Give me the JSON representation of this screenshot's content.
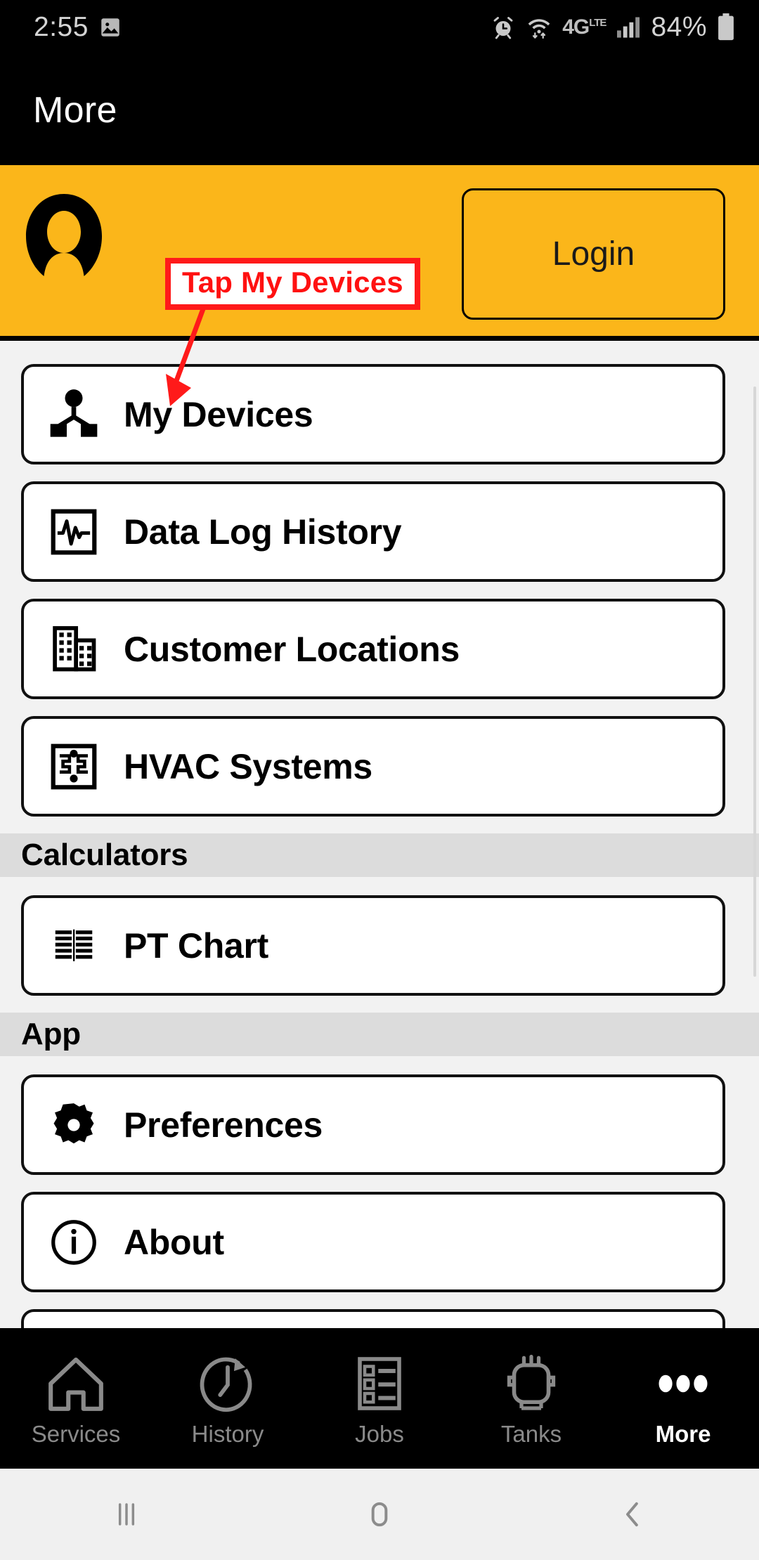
{
  "status_bar": {
    "clock": "2:55",
    "battery_percent": "84%",
    "network": "4G LTE",
    "icons": [
      "image-icon",
      "alarm-icon",
      "wifi-icon",
      "network-4glte-icon",
      "signal-icon",
      "battery-icon"
    ]
  },
  "header": {
    "title": "More"
  },
  "account_bar": {
    "avatar": "person-avatar-icon",
    "login_label": "Login",
    "background_color": "#FBB61A"
  },
  "annotation": {
    "text": "Tap My Devices",
    "color": "#FF1111",
    "border_color": "#FF1A1A",
    "target": "My Devices"
  },
  "menu": {
    "items": [
      {
        "label": "My Devices",
        "icon": "sitemap-icon"
      },
      {
        "label": "Data Log History",
        "icon": "waveform-monitor-icon"
      },
      {
        "label": "Customer Locations",
        "icon": "buildings-icon"
      },
      {
        "label": "HVAC Systems",
        "icon": "hvac-circuit-icon"
      }
    ],
    "sections": [
      {
        "header": "Calculators",
        "items": [
          {
            "label": "PT Chart",
            "icon": "two-column-list-icon"
          }
        ]
      },
      {
        "header": "App",
        "items": [
          {
            "label": "Preferences",
            "icon": "gear-icon"
          },
          {
            "label": "About",
            "icon": "info-circle-icon"
          }
        ]
      }
    ]
  },
  "tab_bar": {
    "tabs": [
      {
        "label": "Services",
        "icon": "home-icon",
        "active": false
      },
      {
        "label": "History",
        "icon": "clock-back-icon",
        "active": false
      },
      {
        "label": "Jobs",
        "icon": "checklist-icon",
        "active": false
      },
      {
        "label": "Tanks",
        "icon": "tank-icon",
        "active": false
      },
      {
        "label": "More",
        "icon": "ellipsis-icon",
        "active": true
      }
    ]
  },
  "system_nav": {
    "buttons": [
      "recents-icon",
      "home-icon",
      "back-icon"
    ]
  }
}
